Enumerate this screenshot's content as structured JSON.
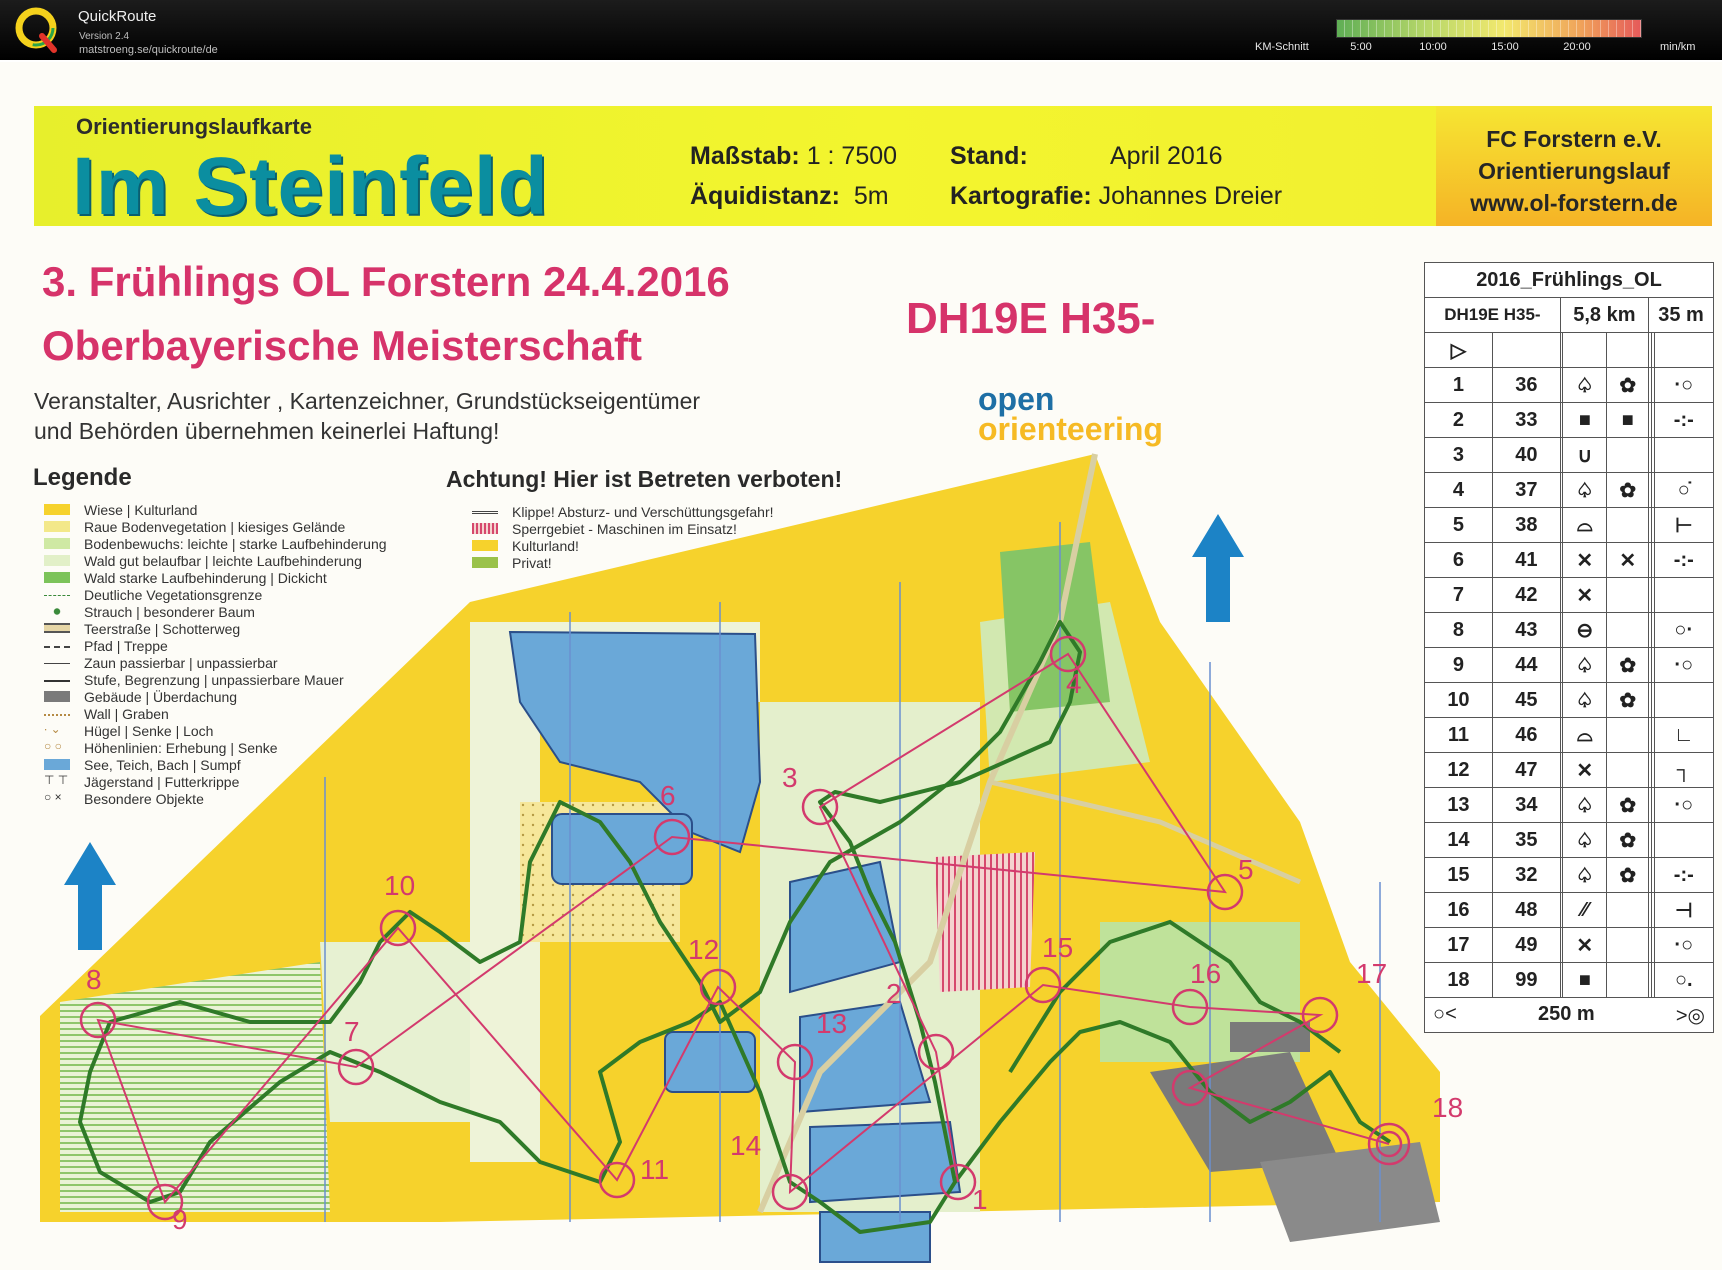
{
  "app": {
    "name": "QuickRoute",
    "version": "Version 2.4",
    "url": "matstroeng.se/quickroute/de",
    "speed_label": "KM-Schnitt",
    "ticks": [
      "5:00",
      "10:00",
      "15:00",
      "20:00"
    ],
    "unit": "min/km"
  },
  "map": {
    "header_small": "Orientierungslaufkarte",
    "title": "Im Steinfeld",
    "scale_label": "Maßstab:",
    "scale_value": "1 : 7500",
    "equi_label": "Äquidistanz:",
    "equi_value": "5m",
    "stand_label": "Stand:",
    "stand_value": "April 2016",
    "carto_label": "Kartografie:",
    "carto_value": "Johannes Dreier",
    "org_line1": "FC Forstern e.V.",
    "org_line2": "Orientierungslauf",
    "org_line3": "www.ol-forstern.de",
    "event_line1": "3. Frühlings OL Forstern  24.4.2016",
    "event_line2": "Oberbayerische Meisterschaft",
    "course": "DH19E  H35-",
    "disclaimer_line1": "Veranstalter, Ausrichter , Kartenzeichner, Grundstückseigentümer",
    "disclaimer_line2": "und Behörden  übernehmen keinerlei Haftung!",
    "oo_line1": "open",
    "oo_line2": "orienteering"
  },
  "legend": {
    "title": "Legende",
    "items": [
      {
        "text": "Wiese | Kulturland",
        "color": "#f6d22c"
      },
      {
        "text": "Raue Bodenvegetation | kiesiges Gelände",
        "color": "#f3e88a"
      },
      {
        "text": "Bodenbewuchs: leichte | starke Laufbehinderung",
        "color": "#cfe9a4"
      },
      {
        "text": "Wald  gut belaufbar | leichte Laufbehinderung",
        "color": "#e2f0c8"
      },
      {
        "text": "Wald  starke Laufbehinderung | Dickicht",
        "color": "#7cc35a"
      },
      {
        "text": "Deutliche Vegetationsgrenze",
        "color": "#ffffff"
      },
      {
        "text": "Strauch | besonderer Baum",
        "color": "#ffffff"
      },
      {
        "text": "Teerstraße | Schotterweg",
        "color": "#e6d6a6"
      },
      {
        "text": "Pfad | Treppe",
        "color": "#ffffff"
      },
      {
        "text": "Zaun  passierbar | unpassierbar",
        "color": "#ffffff"
      },
      {
        "text": "Stufe, Begrenzung | unpassierbare Mauer",
        "color": "#ffffff"
      },
      {
        "text": "Gebäude | Überdachung",
        "color": "#7a7a7a"
      },
      {
        "text": "Wall | Graben",
        "color": "#ffffff"
      },
      {
        "text": "Hügel | Senke | Loch",
        "color": "#ffffff"
      },
      {
        "text": "Höhenlinien: Erhebung | Senke",
        "color": "#ffffff"
      },
      {
        "text": "See, Teich, Bach | Sumpf",
        "color": "#6aa8d8"
      },
      {
        "text": "Jägerstand | Futterkrippe",
        "color": "#ffffff"
      },
      {
        "text": "Besondere Objekte",
        "color": "#ffffff"
      }
    ]
  },
  "warning": {
    "title": "Achtung! Hier ist Betreten verboten!",
    "items": [
      {
        "text": "Klippe! Absturz- und Verschüttungsgefahr!",
        "color": "#555555"
      },
      {
        "text": "Sperrgebiet - Maschinen im Einsatz!",
        "color": "#d85a7a"
      },
      {
        "text": "Kulturland!",
        "color": "#f6d22c"
      },
      {
        "text": "Privat!",
        "color": "#9ac24a"
      }
    ]
  },
  "controls": {
    "title": "2016_Frühlings_OL",
    "course": "DH19E  H35-",
    "length": "5,8 km",
    "climb": "35 m",
    "start_symbol": "▷",
    "footer": "250 m",
    "rows": [
      {
        "n": "1",
        "code": "36",
        "c": "♤",
        "d": "✿",
        "e": "·○"
      },
      {
        "n": "2",
        "code": "33",
        "c": "■",
        "d": "■",
        "e": "-:-"
      },
      {
        "n": "3",
        "code": "40",
        "c": "∪",
        "d": "",
        "e": ""
      },
      {
        "n": "4",
        "code": "37",
        "c": "♤",
        "d": "✿",
        "e": "○̇"
      },
      {
        "n": "5",
        "code": "38",
        "c": "⌓",
        "d": "",
        "e": "⊢"
      },
      {
        "n": "6",
        "code": "41",
        "c": "✕",
        "d": "✕",
        "e": "-:-"
      },
      {
        "n": "7",
        "code": "42",
        "c": "✕",
        "d": "",
        "e": ""
      },
      {
        "n": "8",
        "code": "43",
        "c": "⊖",
        "d": "",
        "e": "○·"
      },
      {
        "n": "9",
        "code": "44",
        "c": "♤",
        "d": "✿",
        "e": "·○"
      },
      {
        "n": "10",
        "code": "45",
        "c": "♤",
        "d": "✿",
        "e": ""
      },
      {
        "n": "11",
        "code": "46",
        "c": "⌓",
        "d": "",
        "e": "∟"
      },
      {
        "n": "12",
        "code": "47",
        "c": "✕",
        "d": "",
        "e": "┐"
      },
      {
        "n": "13",
        "code": "34",
        "c": "♤",
        "d": "✿",
        "e": "·○"
      },
      {
        "n": "14",
        "code": "35",
        "c": "♤",
        "d": "✿",
        "e": ""
      },
      {
        "n": "15",
        "code": "32",
        "c": "♤",
        "d": "✿",
        "e": "-:-"
      },
      {
        "n": "16",
        "code": "48",
        "c": "⁄⁄",
        "d": "",
        "e": "⊣"
      },
      {
        "n": "17",
        "code": "49",
        "c": "✕",
        "d": "",
        "e": "·○"
      },
      {
        "n": "18",
        "code": "99",
        "c": "■",
        "d": "",
        "e": "○."
      }
    ]
  },
  "control_labels": [
    "1",
    "2",
    "3",
    "4",
    "5",
    "6",
    "7",
    "8",
    "9",
    "10",
    "11",
    "12",
    "13",
    "14",
    "15",
    "16",
    "17",
    "18"
  ],
  "colors": {
    "route": "#2f7a28",
    "leg_line": "#d33a6d",
    "field": "#f6d22c",
    "water": "#6aa8d8",
    "forest": "#cfe9a4"
  }
}
